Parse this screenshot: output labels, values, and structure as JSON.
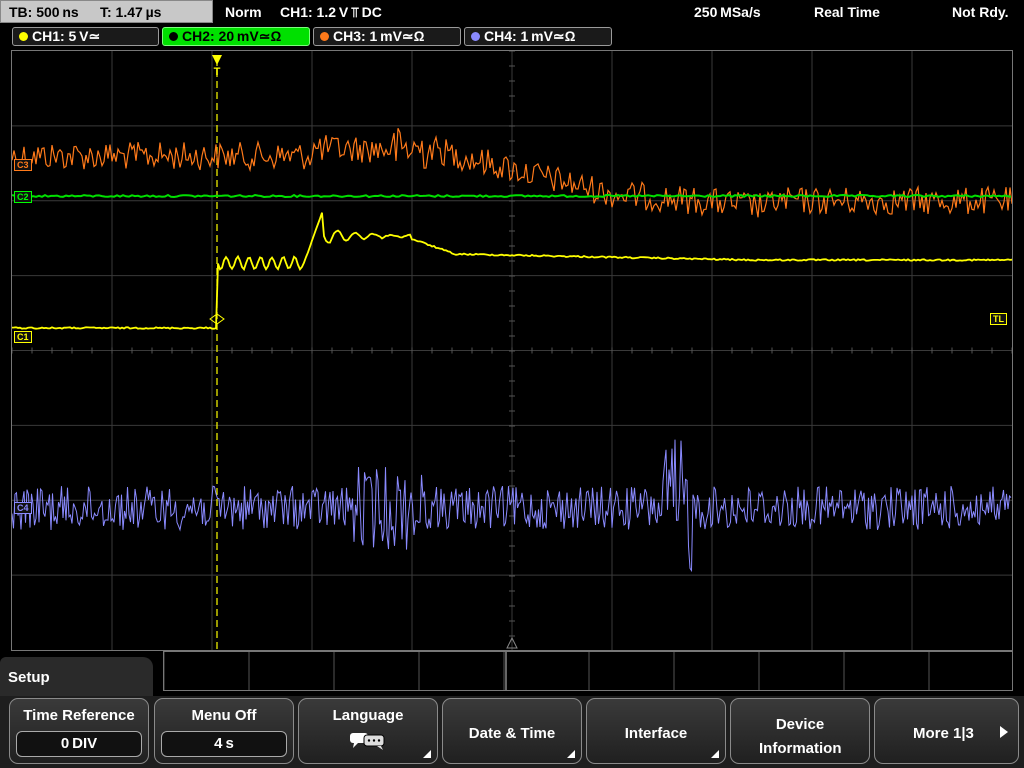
{
  "status": {
    "timebase": "TB: 500 ns",
    "trigger_time": "T: 1.47 µs",
    "trigger_mode": "Norm",
    "trigger_info": "CH1: 1.2 V ⫪ DC",
    "sample_rate": "250 MSa/s",
    "acq_mode": "Real Time",
    "state": "Not Rdy."
  },
  "channels": [
    {
      "label": "CH1: 5 V≃",
      "color": "#ffff00"
    },
    {
      "label": "CH2: 20 mV≃Ω",
      "color": "#00ff00"
    },
    {
      "label": "CH3: 1 mV≃Ω",
      "color": "#ff7a1a"
    },
    {
      "label": "CH4: 1 mV≃Ω",
      "color": "#8a8aff"
    }
  ],
  "markers": {
    "c1": "C1",
    "c2": "C2",
    "c3": "C3",
    "c4": "C4",
    "trigger_level": "TL"
  },
  "menu": {
    "title": "Setup",
    "buttons": [
      {
        "label": "Time Reference",
        "value": "0 DIV"
      },
      {
        "label": "Menu Off",
        "value": "4 s"
      },
      {
        "label": "Language",
        "icon": "speech-bubbles-icon"
      },
      {
        "label": "Date & Time"
      },
      {
        "label": "Interface"
      },
      {
        "label": "Device Information"
      },
      {
        "label": "More 1|3"
      }
    ]
  }
}
